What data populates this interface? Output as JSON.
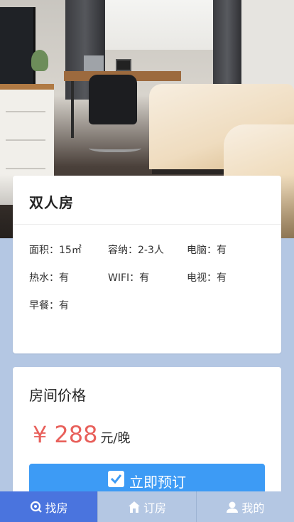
{
  "room": {
    "name": "双人房",
    "amenities": [
      {
        "label": "面积：",
        "value": "15㎡"
      },
      {
        "label": "容纳：",
        "value": "2-3人"
      },
      {
        "label": "电脑：",
        "value": "有"
      },
      {
        "label": "热水：",
        "value": "有"
      },
      {
        "label": "WIFI：",
        "value": "有"
      },
      {
        "label": "电视：",
        "value": "有"
      },
      {
        "label": "早餐：",
        "value": "有"
      }
    ]
  },
  "price": {
    "title": "房间价格",
    "currency": "¥",
    "amount": "288",
    "unit": "元/晚",
    "color": "#e8605b"
  },
  "actions": {
    "book_label": "立即预订",
    "book_color": "#3d9bf5"
  },
  "nav": {
    "items": [
      {
        "label": "找房",
        "icon": "search-icon",
        "active": true
      },
      {
        "label": "订房",
        "icon": "home-icon",
        "active": false
      },
      {
        "label": "我的",
        "icon": "user-icon",
        "active": false
      }
    ],
    "active_color": "#4a74de",
    "inactive_color": "#b4c7e3"
  }
}
